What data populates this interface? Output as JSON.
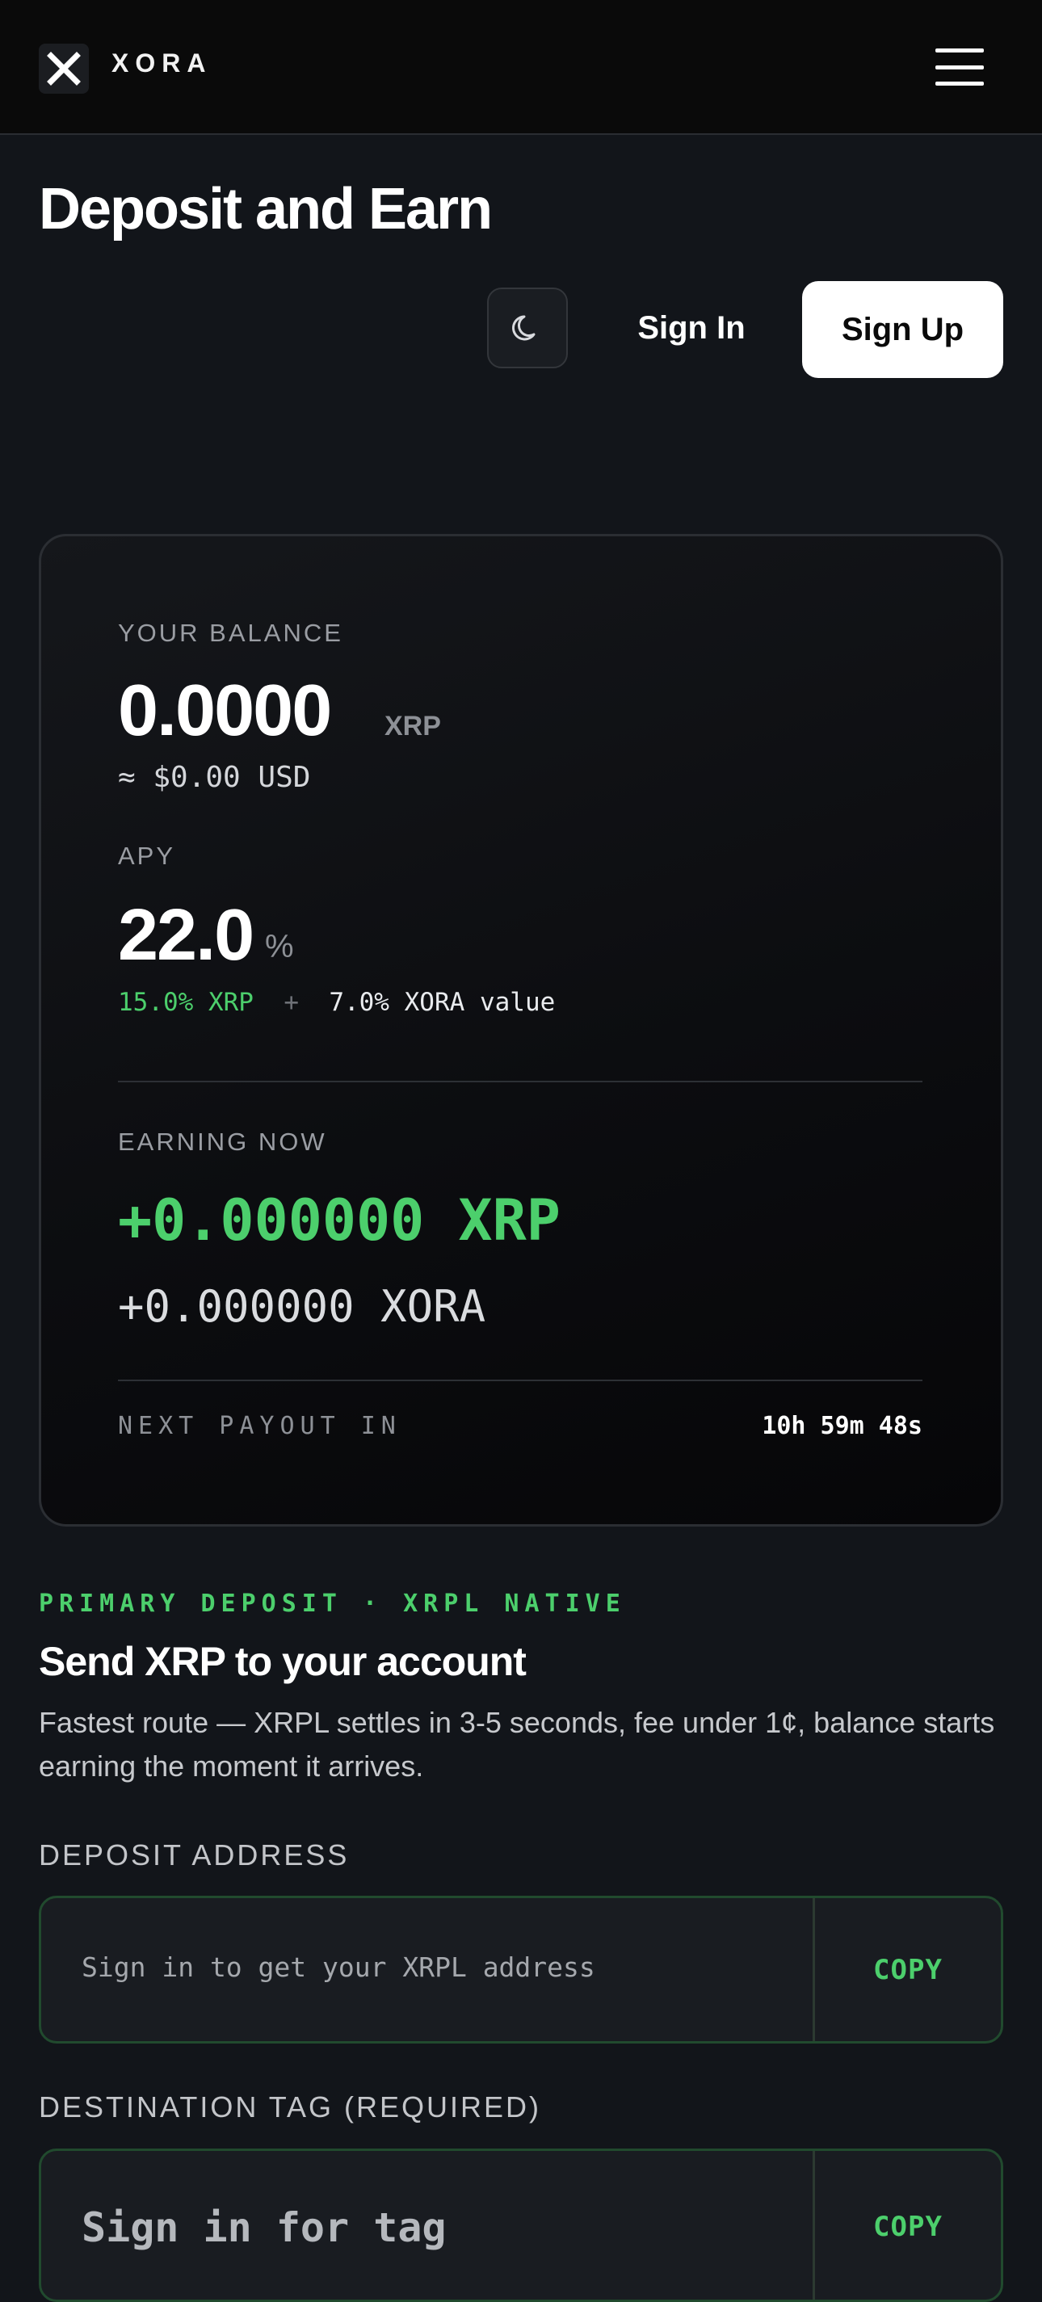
{
  "header": {
    "brand": "XORA",
    "logo_icon": "x-logo-icon",
    "menu_icon": "hamburger-menu-icon"
  },
  "page": {
    "title": "Deposit and Earn",
    "theme_icon": "moon-icon",
    "sign_in": "Sign In",
    "sign_up": "Sign Up"
  },
  "balance_card": {
    "balance_label": "YOUR BALANCE",
    "balance_value": "0.0000",
    "balance_unit": "XRP",
    "balance_usd": "≈ $0.00 USD",
    "apy_label": "APY",
    "apy_value": "22.0",
    "apy_unit": "%",
    "apy_xrp_part": "15.0% XRP",
    "apy_plus": "+",
    "apy_xora_part": "7.0% XORA value",
    "earning_label": "EARNING NOW",
    "earning_xrp": "+0.000000 XRP",
    "earning_xora": "+0.000000 XORA",
    "payout_label": "NEXT PAYOUT IN",
    "payout_time": "10h 59m 48s"
  },
  "deposit": {
    "tag": "PRIMARY DEPOSIT · XRPL NATIVE",
    "title": "Send XRP to your account",
    "description": "Fastest route — XRPL settles in 3-5 seconds, fee under 1¢, balance starts earning the moment it arrives.",
    "address_label": "DEPOSIT ADDRESS",
    "address_value": "Sign in to get your XRPL address",
    "address_copy": "COPY",
    "tag_label": "DESTINATION TAG (REQUIRED)",
    "tag_value": "Sign in for tag",
    "tag_copy": "COPY"
  },
  "colors": {
    "accent_green": "#4ccf6c",
    "background": "#12151a",
    "topbar": "#0a0a0a"
  }
}
